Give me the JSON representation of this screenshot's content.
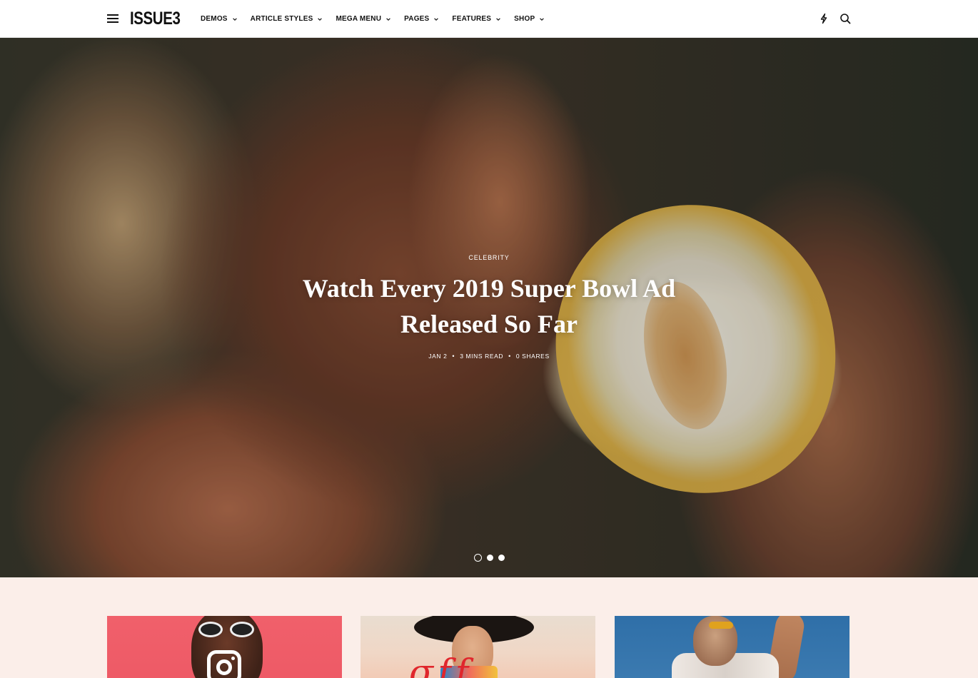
{
  "header": {
    "logo": "ISSUE3",
    "nav": [
      {
        "label": "DEMOS"
      },
      {
        "label": "ARTICLE STYLES"
      },
      {
        "label": "MEGA MENU"
      },
      {
        "label": "PAGES"
      },
      {
        "label": "FEATURES"
      },
      {
        "label": "SHOP"
      }
    ],
    "icons": [
      "menu-icon",
      "bolt-icon",
      "search-icon",
      "chevron-down-icon"
    ]
  },
  "hero": {
    "category": "CELEBRITY",
    "title": "Watch Every 2019 Super Bowl Ad Released So Far",
    "meta": {
      "date": "JAN 2",
      "read_time": "3 MINS READ",
      "shares": "0 SHARES"
    },
    "slides": {
      "count": 3,
      "active": 1
    }
  },
  "cards": [
    {
      "name": "card-1",
      "image": "woman with sunglasses and instagram icon on pink background"
    },
    {
      "name": "card-2",
      "image": "woman in black hat with red script lettering"
    },
    {
      "name": "card-3",
      "image": "woman in sunglasses against blue sky"
    }
  ],
  "colors": {
    "header_bg": "#ffffff",
    "page_bg": "#fbeee9",
    "card1_bg": "#f0606b",
    "card3_bg": "#2f6fa8",
    "text": "#111111"
  }
}
